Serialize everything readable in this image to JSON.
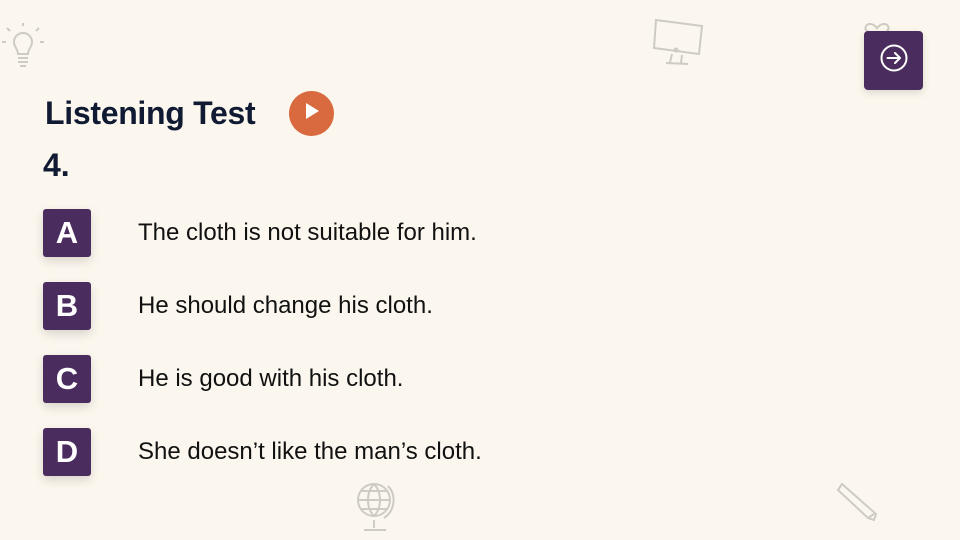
{
  "colors": {
    "background": "#fbf7ee",
    "accent_purple": "#4a2d5e",
    "play_orange": "#d96a3f",
    "title_text": "#101a33"
  },
  "header": {
    "title": "Listening Test",
    "play_icon": "play-icon",
    "next_icon": "arrow-right-circle-icon"
  },
  "question": {
    "number": "4."
  },
  "options": [
    {
      "letter": "A",
      "text": "The cloth is not suitable for him."
    },
    {
      "letter": "B",
      "text": "He should change his cloth."
    },
    {
      "letter": "C",
      "text": "He is good with his cloth."
    },
    {
      "letter": "D",
      "text": "She doesn’t like the man’s cloth."
    }
  ],
  "decorations": [
    "lightbulb-icon",
    "monitor-icon",
    "heart-icon",
    "globe-icon",
    "pencil-icon"
  ]
}
